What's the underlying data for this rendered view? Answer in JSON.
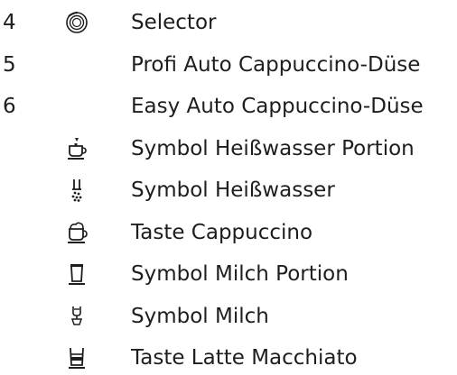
{
  "items": [
    {
      "number": "4",
      "icon": "selector-dial-icon",
      "label": "Selector"
    },
    {
      "number": "5",
      "icon": "",
      "label": "Profi Auto Cappuccino-Düse"
    },
    {
      "number": "6",
      "icon": "",
      "label": "Easy Auto Cappuccino-Düse"
    },
    {
      "number": "",
      "icon": "hot-water-portion-cup-icon",
      "label": "Symbol Heißwasser Portion"
    },
    {
      "number": "",
      "icon": "hot-water-spout-icon",
      "label": "Symbol Heißwasser"
    },
    {
      "number": "",
      "icon": "cappuccino-cup-icon",
      "label": "Taste Cappuccino"
    },
    {
      "number": "",
      "icon": "milk-portion-glass-icon",
      "label": "Symbol Milch Portion"
    },
    {
      "number": "",
      "icon": "milk-dispenser-icon",
      "label": "Symbol Milch"
    },
    {
      "number": "",
      "icon": "latte-macchiato-glass-icon",
      "label": "Taste Latte Macchiato"
    }
  ]
}
